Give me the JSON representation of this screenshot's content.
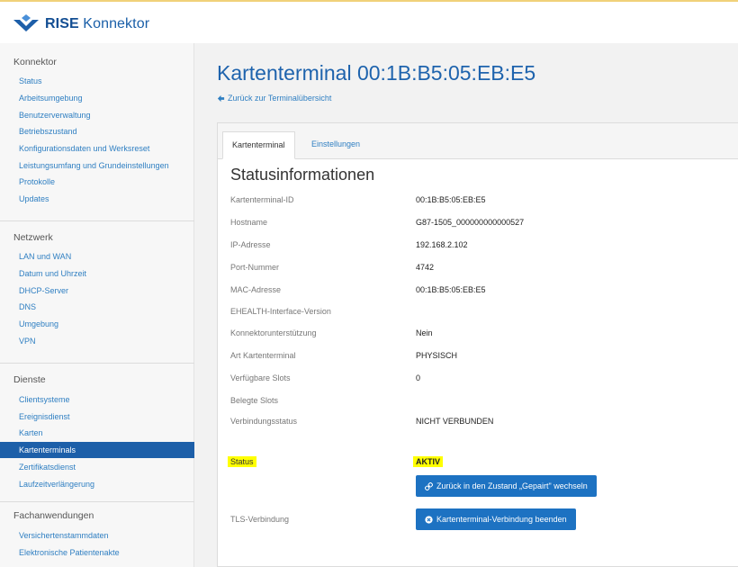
{
  "header": {
    "brand_bold": "RISE",
    "brand_rest": " Konnektor",
    "accent_color": "#1d5fa9",
    "logo_icon": "rise-logo-icon"
  },
  "sidebar": {
    "sections": [
      {
        "title": "Konnektor",
        "items": [
          {
            "label": "Status"
          },
          {
            "label": "Arbeitsumgebung"
          },
          {
            "label": "Benutzerverwaltung"
          },
          {
            "label": "Betriebszustand"
          },
          {
            "label": "Konfigurationsdaten und Werksreset"
          },
          {
            "label": "Leistungsumfang und Grundeinstellungen"
          },
          {
            "label": "Protokolle"
          },
          {
            "label": "Updates"
          }
        ]
      },
      {
        "title": "Netzwerk",
        "items": [
          {
            "label": "LAN und WAN"
          },
          {
            "label": "Datum und Uhrzeit"
          },
          {
            "label": "DHCP-Server"
          },
          {
            "label": "DNS"
          },
          {
            "label": "Umgebung"
          },
          {
            "label": "VPN"
          }
        ]
      },
      {
        "title": "Dienste",
        "items": [
          {
            "label": "Clientsysteme"
          },
          {
            "label": "Ereignisdienst"
          },
          {
            "label": "Karten"
          },
          {
            "label": "Kartenterminals",
            "active": true
          },
          {
            "label": "Zertifikatsdienst"
          },
          {
            "label": "Laufzeitverlängerung"
          }
        ]
      },
      {
        "title": "Fachanwendungen",
        "items": [
          {
            "label": "Versichertenstammdaten"
          },
          {
            "label": "Elektronische Patientenakte"
          }
        ]
      }
    ]
  },
  "main": {
    "title": "Kartenterminal 00:1B:B5:05:EB:E5",
    "back_link": "Zurück zur Terminalübersicht",
    "tabs": [
      {
        "label": "Kartenterminal",
        "active": true
      },
      {
        "label": "Einstellungen",
        "active": false
      }
    ],
    "section_title": "Statusinformationen",
    "rows": [
      {
        "label": "Kartenterminal-ID",
        "value": "00:1B:B5:05:EB:E5"
      },
      {
        "label": "Hostname",
        "value": "G87-1505_000000000000527"
      },
      {
        "label": "IP-Adresse",
        "value": "192.168.2.102"
      },
      {
        "label": "Port-Nummer",
        "value": "4742"
      },
      {
        "label": "MAC-Adresse",
        "value": "00:1B:B5:05:EB:E5"
      },
      {
        "label": "EHEALTH-Interface-Version",
        "value": ""
      },
      {
        "label": "Konnektorunterstützung",
        "value": "Nein"
      },
      {
        "label": "Art Kartenterminal",
        "value": "PHYSISCH"
      },
      {
        "label": "Verfügbare Slots",
        "value": "0"
      },
      {
        "label": "Belegte Slots",
        "value": ""
      },
      {
        "label": "Verbindungsstatus",
        "value": "NICHT VERBUNDEN"
      }
    ],
    "status": {
      "label": "Status",
      "value": "AKTIV",
      "highlight_color": "#ffff00"
    },
    "pair_button": {
      "label": "Zurück in den Zustand „Gepairt\" wechseln",
      "icon": "link-icon"
    },
    "tls": {
      "label": "TLS-Verbindung"
    },
    "end_button": {
      "label": "Kartenterminal-Verbindung beenden",
      "icon": "x-circle-icon"
    },
    "button_color": "#1d72c2"
  }
}
